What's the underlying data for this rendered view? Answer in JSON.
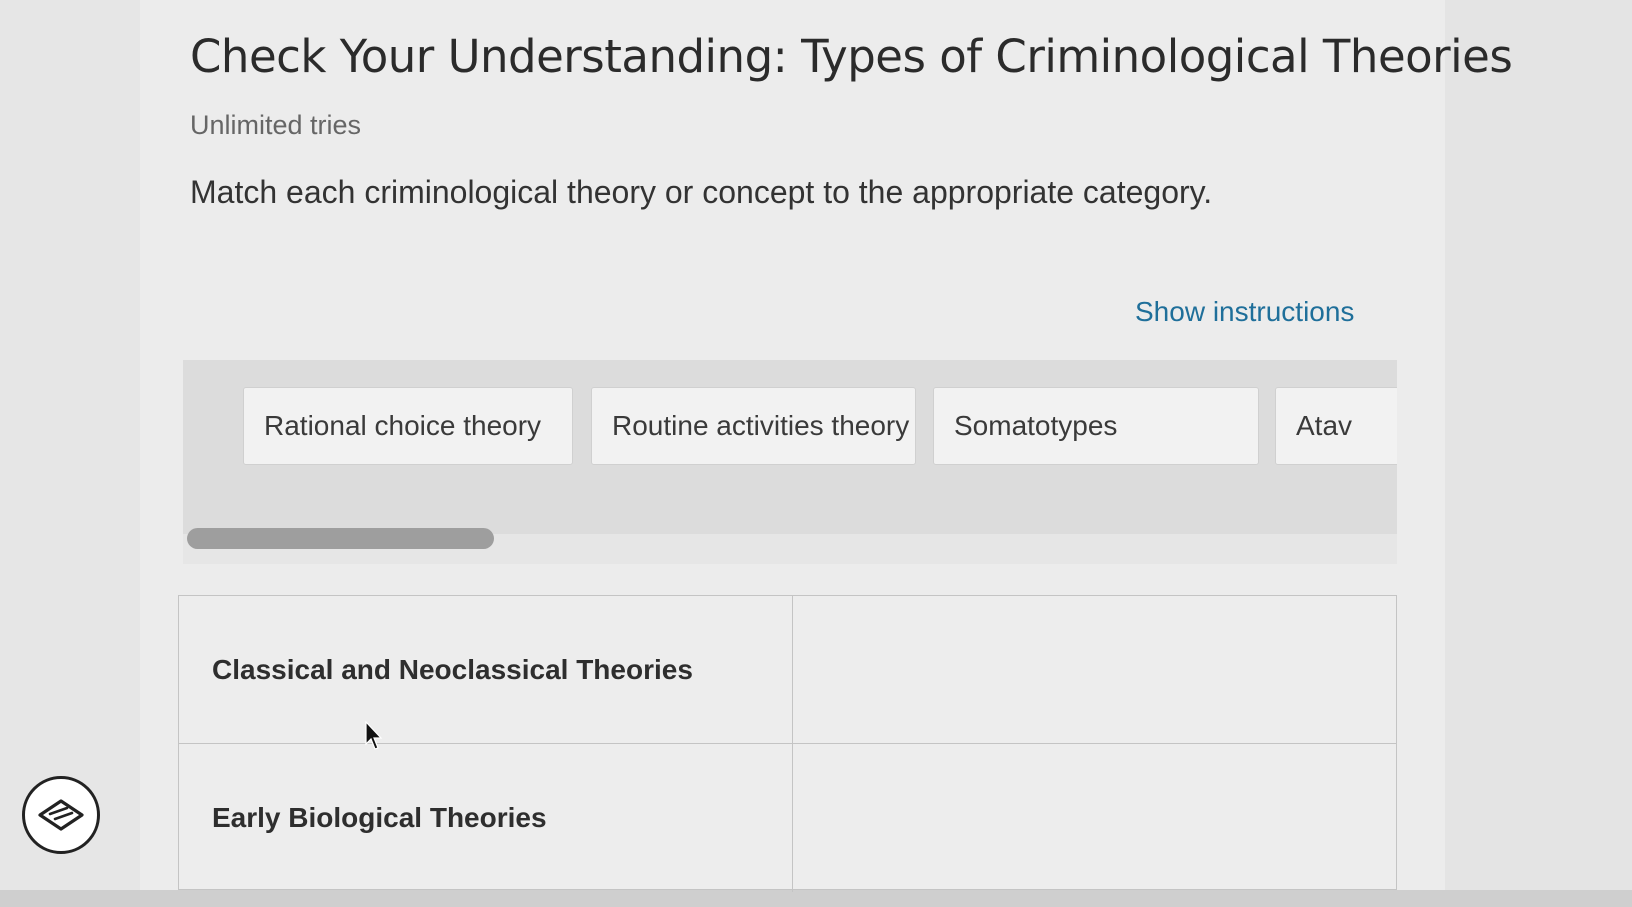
{
  "page": {
    "title": "Check Your Understanding: Types of Criminological Theories",
    "tries": "Unlimited tries",
    "prompt": "Match each criminological theory or concept to the appropriate category.",
    "show_instructions": "Show instructions"
  },
  "bank": {
    "items": [
      {
        "label": "Rational choice theory"
      },
      {
        "label": "Routine activities theory"
      },
      {
        "label": "Somatotypes"
      },
      {
        "label": "Atav"
      }
    ]
  },
  "table": {
    "rows": [
      {
        "category": "Classical and Neoclassical Theories"
      },
      {
        "category": "Early Biological Theories"
      }
    ]
  },
  "icons": {
    "badge": "eraser-icon",
    "cursor": "mouse-pointer-icon"
  },
  "colors": {
    "link": "#1f6f9a",
    "page_bg": "#ececec"
  }
}
